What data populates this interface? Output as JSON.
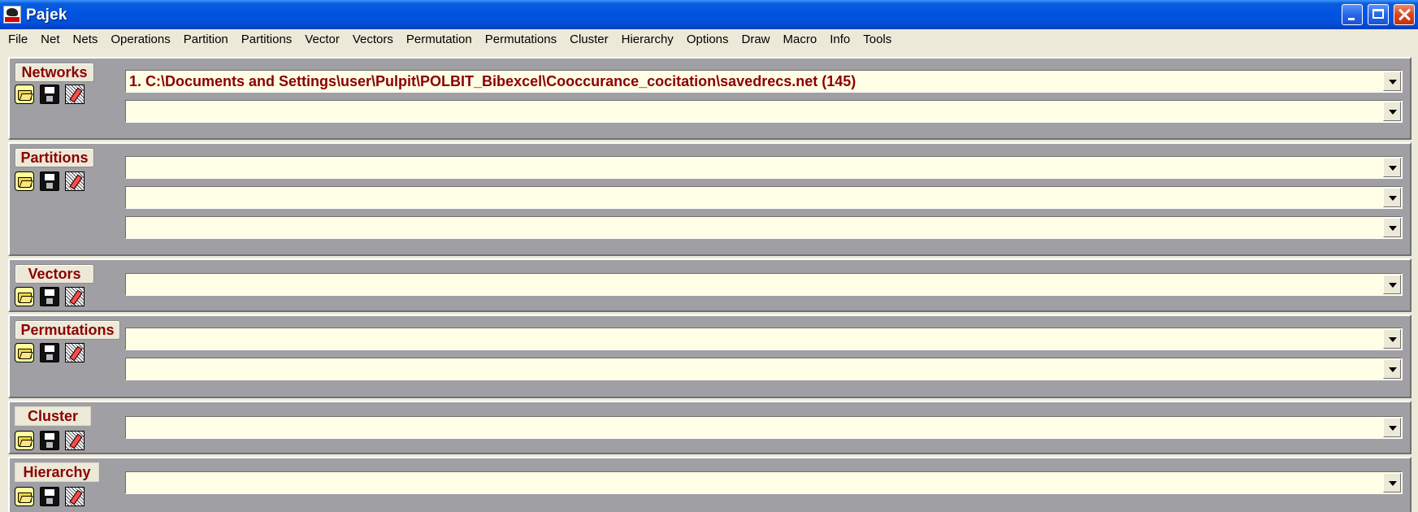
{
  "window": {
    "title": "Pajek"
  },
  "menu": [
    "File",
    "Net",
    "Nets",
    "Operations",
    "Partition",
    "Partitions",
    "Vector",
    "Vectors",
    "Permutation",
    "Permutations",
    "Cluster",
    "Hierarchy",
    "Options",
    "Draw",
    "Macro",
    "Info",
    "Tools"
  ],
  "panels": {
    "networks": {
      "label": "Networks",
      "fields": [
        "1. C:\\Documents and Settings\\user\\Pulpit\\POLBIT_Bibexcel\\Cooccurance_cocitation\\savedrecs.net (145)",
        ""
      ]
    },
    "partitions": {
      "label": "Partitions",
      "fields": [
        "",
        "",
        ""
      ]
    },
    "vectors": {
      "label": "Vectors",
      "fields": [
        ""
      ]
    },
    "permutations": {
      "label": "Permutations",
      "fields": [
        "",
        ""
      ]
    },
    "cluster": {
      "label": "Cluster",
      "fields": [
        ""
      ]
    },
    "hierarchy": {
      "label": "Hierarchy",
      "fields": [
        ""
      ]
    }
  },
  "icons": [
    "open-folder-icon",
    "save-disk-icon",
    "edit-icon"
  ],
  "colors": {
    "label_text": "#8b0000",
    "field_background": "#fffee6",
    "panel_background": "#a0a0a4",
    "titlebar": "#0054e3"
  }
}
